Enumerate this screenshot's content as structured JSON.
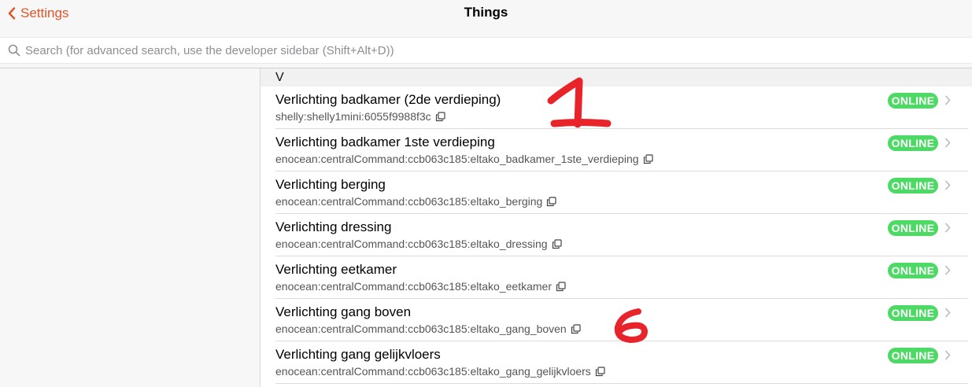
{
  "nav": {
    "back_label": "Settings",
    "title": "Things"
  },
  "search": {
    "placeholder": "Search (for advanced search, use the developer sidebar (Shift+Alt+D))"
  },
  "section": {
    "letter": "V"
  },
  "items": [
    {
      "title": "Verlichting badkamer (2de verdieping)",
      "uid": "shelly:shelly1mini:6055f9988f3c",
      "status": "ONLINE"
    },
    {
      "title": "Verlichting badkamer 1ste verdieping",
      "uid": "enocean:centralCommand:ccb063c185:eltako_badkamer_1ste_verdieping",
      "status": "ONLINE"
    },
    {
      "title": "Verlichting berging",
      "uid": "enocean:centralCommand:ccb063c185:eltako_berging",
      "status": "ONLINE"
    },
    {
      "title": "Verlichting dressing",
      "uid": "enocean:centralCommand:ccb063c185:eltako_dressing",
      "status": "ONLINE"
    },
    {
      "title": "Verlichting eetkamer",
      "uid": "enocean:centralCommand:ccb063c185:eltako_eetkamer",
      "status": "ONLINE"
    },
    {
      "title": "Verlichting gang boven",
      "uid": "enocean:centralCommand:ccb063c185:eltako_gang_boven",
      "status": "ONLINE"
    },
    {
      "title": "Verlichting gang gelijkvloers",
      "uid": "enocean:centralCommand:ccb063c185:eltako_gang_gelijkvloers",
      "status": "ONLINE"
    }
  ],
  "colors": {
    "accent": "#e2542a",
    "online": "#4cd964",
    "annotation": "#e8232a"
  },
  "icons": [
    "chevron-left-icon",
    "search-icon",
    "copy-icon",
    "chevron-right-icon"
  ]
}
